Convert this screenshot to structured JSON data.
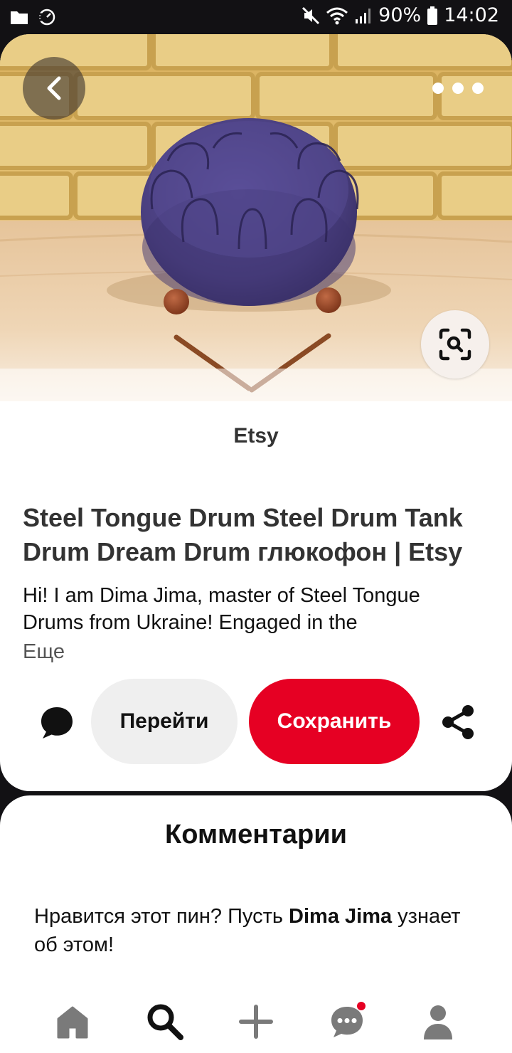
{
  "status_bar": {
    "battery": "90%",
    "time": "14:02",
    "icons": [
      "folder-icon",
      "data-saver-icon",
      "mute-icon",
      "wifi-icon",
      "signal-icon",
      "battery-icon"
    ]
  },
  "pin": {
    "source": "Etsy",
    "title": "Steel Tongue Drum Steel Drum Tank Drum Dream Drum глюкофон | Etsy",
    "description": "Hi! I am Dima Jima, master of Steel Tongue Drums from Ukraine! Engaged in the",
    "more_label": "Еще",
    "image_icons": [
      "back-icon",
      "more-icon",
      "visual-search-icon"
    ]
  },
  "actions": {
    "go_label": "Перейти",
    "save_label": "Сохранить",
    "icons": [
      "comment-icon",
      "share-icon"
    ]
  },
  "comments": {
    "title": "Комментарии",
    "prompt_before": "Нравится этот пин? Пусть ",
    "prompt_user": "Dima Jima",
    "prompt_after": " узнает об этом!"
  },
  "bottom_nav": {
    "items": [
      "home-icon",
      "search-icon",
      "create-icon",
      "messages-icon",
      "profile-icon"
    ]
  },
  "colors": {
    "brand_red": "#e60023",
    "drum_purple": "#4f4386",
    "dark_background": "#121114"
  }
}
